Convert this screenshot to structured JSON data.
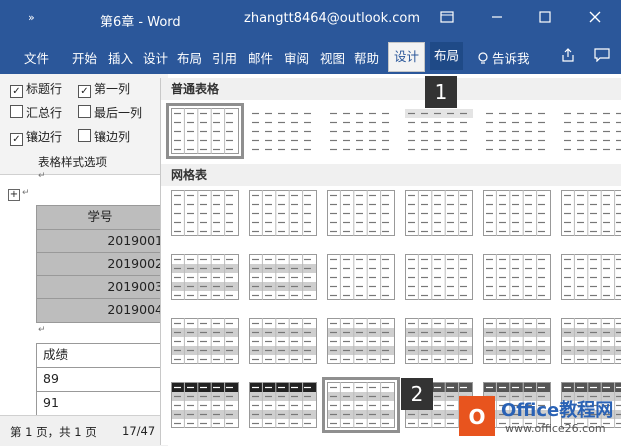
{
  "titlebar": {
    "qa_glyph": "»",
    "doc_title": "第6章  -  Word",
    "account": "zhangtt8464@outlook.com"
  },
  "tabs": [
    "文件",
    "开始",
    "插入",
    "设计",
    "布局",
    "引用",
    "邮件",
    "审阅",
    "视图",
    "帮助",
    "设计",
    "布局"
  ],
  "tell_me": "告诉我",
  "options": {
    "items": [
      {
        "label": "标题行",
        "checked": true
      },
      {
        "label": "第一列",
        "checked": true
      },
      {
        "label": "汇总行",
        "checked": false
      },
      {
        "label": "最后一列",
        "checked": false
      },
      {
        "label": "镶边行",
        "checked": true
      },
      {
        "label": "镶边列",
        "checked": false
      }
    ],
    "caption": "表格样式选项"
  },
  "doc": {
    "header_cell": "学号",
    "ids": [
      "2019001",
      "2019002",
      "2019003",
      "2019004"
    ],
    "grade_label": "成绩",
    "grade_value": "89",
    "cut_text": "91",
    "para_mark": "↵"
  },
  "status": {
    "page": "第 1 页，共 1 页",
    "words": "17/47"
  },
  "gallery": {
    "section1": "普通表格",
    "section2": "网格表"
  },
  "callouts": [
    "1",
    "2"
  ],
  "watermark": {
    "brand": "Office教程网",
    "url": "www.office26.com"
  },
  "colors": {
    "ribbon": "#2b579a",
    "accent": "#e8541e"
  }
}
